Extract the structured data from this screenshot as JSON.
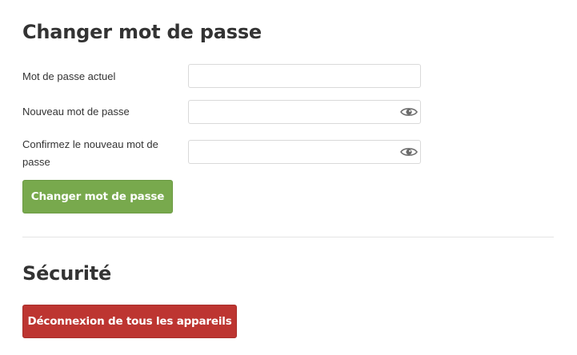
{
  "password_section": {
    "title": "Changer mot de passe",
    "fields": [
      {
        "label": "Mot de passe actuel",
        "value": "",
        "has_visibility_toggle": false
      },
      {
        "label": "Nouveau mot de passe",
        "value": "",
        "has_visibility_toggle": true
      },
      {
        "label": "Confirmez le nouveau mot de passe",
        "value": "",
        "has_visibility_toggle": true
      }
    ],
    "submit_label": "Changer mot de passe",
    "submit_color": "#78a94d",
    "visibility_icon": "eye-icon"
  },
  "security_section": {
    "title": "Sécurité",
    "logout_all_label": "Déconnexion de tous les appareils",
    "logout_all_color": "#bd3531"
  }
}
